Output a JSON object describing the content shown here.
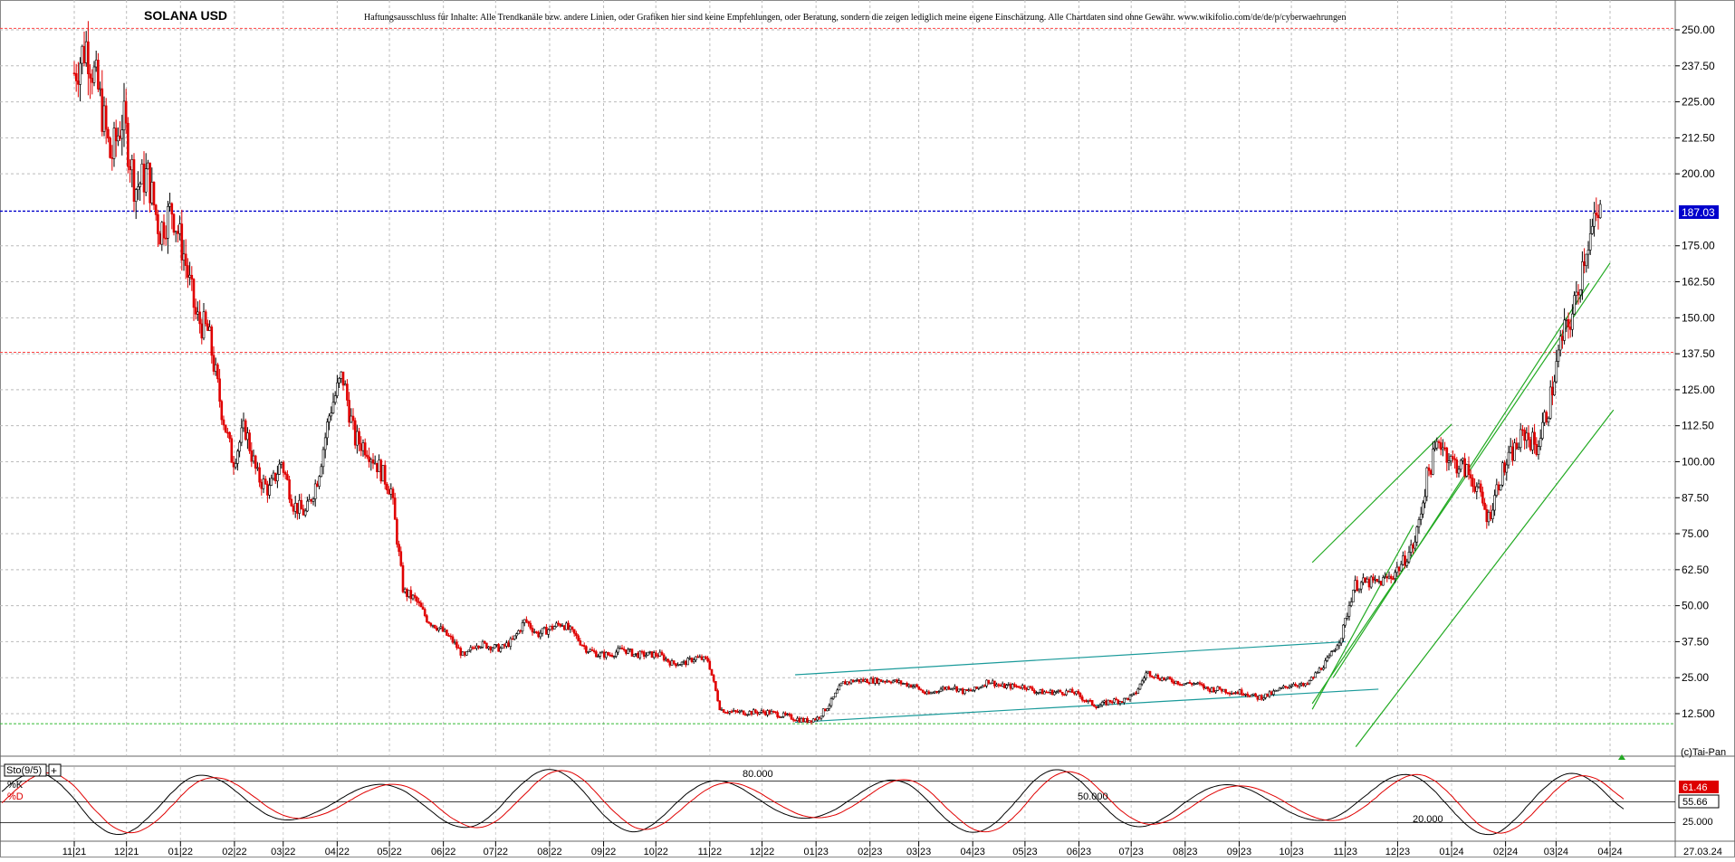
{
  "chart_data": {
    "type": "candlestick",
    "title": "SOLANA USD",
    "disclaimer": "Haftungsausschluss für Inhalte: Alle Trendkanäle bzw. andere Linien, oder Grafiken hier sind keine Empfehlungen, oder Beratung, sondern die zeigen lediglich meine eigene Einschätzung. Alle Chartdaten sind ohne Gewähr. www.wikifolio.com/de/de/p/cyberwaehrungen",
    "copyright": "(c)Tai-Pan",
    "y_ticks": [
      "250.00",
      "237.50",
      "225.00",
      "212.50",
      "200.00",
      "175.00",
      "162.50",
      "150.00",
      "137.50",
      "125.00",
      "112.50",
      "100.00",
      "87.50",
      "75.00",
      "62.50",
      "50.00",
      "37.50",
      "25.00",
      "12.500"
    ],
    "ylim": [
      0,
      254
    ],
    "last_price": "187.03",
    "x_ticks": [
      "11|21",
      "12|21",
      "01|22",
      "02|22",
      "03|22",
      "04|22",
      "05|22",
      "06|22",
      "07|22",
      "08|22",
      "09|22",
      "10|22",
      "11|22",
      "12|22",
      "01|23",
      "02|23",
      "03|23",
      "04|23",
      "05|23",
      "06|23",
      "07|23",
      "08|23",
      "09|23",
      "10|23",
      "11|23",
      "12|23",
      "01|24",
      "02|24",
      "03|24",
      "04|24"
    ],
    "x_date_label": "27.03.24",
    "reference_lines": [
      {
        "value": 250.5,
        "color": "#ff4444",
        "style": "dotted"
      },
      {
        "value": 187.03,
        "color": "#0000cc",
        "style": "dotted"
      },
      {
        "value": 138,
        "color": "#ff4444",
        "style": "dotted"
      },
      {
        "value": 9,
        "color": "#33bb33",
        "style": "dotted"
      }
    ],
    "price_path": [
      [
        "2021-11-01",
        235
      ],
      [
        "2021-11-08",
        245
      ],
      [
        "2021-11-15",
        228
      ],
      [
        "2021-11-22",
        205
      ],
      [
        "2021-11-29",
        220
      ],
      [
        "2021-12-06",
        195
      ],
      [
        "2021-12-13",
        200
      ],
      [
        "2021-12-20",
        180
      ],
      [
        "2021-12-27",
        188
      ],
      [
        "2022-01-03",
        172
      ],
      [
        "2022-01-10",
        150
      ],
      [
        "2022-01-17",
        145
      ],
      [
        "2022-01-24",
        120
      ],
      [
        "2022-01-31",
        100
      ],
      [
        "2022-02-07",
        112
      ],
      [
        "2022-02-14",
        95
      ],
      [
        "2022-02-21",
        90
      ],
      [
        "2022-02-28",
        100
      ],
      [
        "2022-03-07",
        85
      ],
      [
        "2022-03-14",
        82
      ],
      [
        "2022-03-21",
        95
      ],
      [
        "2022-03-28",
        118
      ],
      [
        "2022-04-04",
        130
      ],
      [
        "2022-04-11",
        108
      ],
      [
        "2022-04-18",
        105
      ],
      [
        "2022-04-25",
        98
      ],
      [
        "2022-05-02",
        90
      ],
      [
        "2022-05-09",
        55
      ],
      [
        "2022-05-16",
        52
      ],
      [
        "2022-05-23",
        45
      ],
      [
        "2022-05-30",
        42
      ],
      [
        "2022-06-06",
        38
      ],
      [
        "2022-06-13",
        32
      ],
      [
        "2022-06-20",
        37
      ],
      [
        "2022-06-27",
        36
      ],
      [
        "2022-07-04",
        35
      ],
      [
        "2022-07-11",
        38
      ],
      [
        "2022-07-18",
        45
      ],
      [
        "2022-07-25",
        40
      ],
      [
        "2022-08-01",
        42
      ],
      [
        "2022-08-08",
        44
      ],
      [
        "2022-08-15",
        40
      ],
      [
        "2022-08-22",
        35
      ],
      [
        "2022-08-29",
        33
      ],
      [
        "2022-09-05",
        33
      ],
      [
        "2022-09-12",
        35
      ],
      [
        "2022-09-19",
        33
      ],
      [
        "2022-09-26",
        33
      ],
      [
        "2022-10-03",
        33
      ],
      [
        "2022-10-10",
        30
      ],
      [
        "2022-10-17",
        30
      ],
      [
        "2022-10-24",
        32
      ],
      [
        "2022-10-31",
        31
      ],
      [
        "2022-11-07",
        14
      ],
      [
        "2022-11-14",
        13
      ],
      [
        "2022-11-21",
        13
      ],
      [
        "2022-11-28",
        13
      ],
      [
        "2022-12-05",
        13
      ],
      [
        "2022-12-12",
        12
      ],
      [
        "2022-12-19",
        11
      ],
      [
        "2022-12-26",
        10
      ],
      [
        "2023-01-02",
        11
      ],
      [
        "2023-01-09",
        16
      ],
      [
        "2023-01-16",
        23
      ],
      [
        "2023-01-23",
        24
      ],
      [
        "2023-01-30",
        24
      ],
      [
        "2023-02-06",
        24
      ],
      [
        "2023-02-13",
        24
      ],
      [
        "2023-02-20",
        23
      ],
      [
        "2023-02-27",
        22
      ],
      [
        "2023-03-06",
        19
      ],
      [
        "2023-03-13",
        21
      ],
      [
        "2023-03-20",
        22
      ],
      [
        "2023-03-27",
        20
      ],
      [
        "2023-04-03",
        21
      ],
      [
        "2023-04-10",
        24
      ],
      [
        "2023-04-17",
        22
      ],
      [
        "2023-04-24",
        22
      ],
      [
        "2023-05-01",
        22
      ],
      [
        "2023-05-08",
        20
      ],
      [
        "2023-05-15",
        20
      ],
      [
        "2023-05-22",
        20
      ],
      [
        "2023-05-29",
        20
      ],
      [
        "2023-06-05",
        17
      ],
      [
        "2023-06-12",
        15
      ],
      [
        "2023-06-19",
        17
      ],
      [
        "2023-06-26",
        17
      ],
      [
        "2023-07-03",
        19
      ],
      [
        "2023-07-10",
        27
      ],
      [
        "2023-07-17",
        25
      ],
      [
        "2023-07-24",
        24
      ],
      [
        "2023-07-31",
        23
      ],
      [
        "2023-08-07",
        23
      ],
      [
        "2023-08-14",
        21
      ],
      [
        "2023-08-21",
        21
      ],
      [
        "2023-08-28",
        20
      ],
      [
        "2023-09-04",
        20
      ],
      [
        "2023-09-11",
        18
      ],
      [
        "2023-09-18",
        19
      ],
      [
        "2023-09-25",
        21
      ],
      [
        "2023-10-02",
        23
      ],
      [
        "2023-10-09",
        22
      ],
      [
        "2023-10-16",
        27
      ],
      [
        "2023-10-23",
        32
      ],
      [
        "2023-10-30",
        40
      ],
      [
        "2023-11-06",
        57
      ],
      [
        "2023-11-13",
        58
      ],
      [
        "2023-11-20",
        58
      ],
      [
        "2023-11-27",
        60
      ],
      [
        "2023-12-04",
        65
      ],
      [
        "2023-12-11",
        72
      ],
      [
        "2023-12-18",
        95
      ],
      [
        "2023-12-25",
        108
      ],
      [
        "2024-01-01",
        100
      ],
      [
        "2024-01-08",
        98
      ],
      [
        "2024-01-15",
        92
      ],
      [
        "2024-01-22",
        80
      ],
      [
        "2024-01-29",
        95
      ],
      [
        "2024-02-05",
        103
      ],
      [
        "2024-02-12",
        110
      ],
      [
        "2024-02-19",
        105
      ],
      [
        "2024-02-26",
        120
      ],
      [
        "2024-03-04",
        142
      ],
      [
        "2024-03-11",
        152
      ],
      [
        "2024-03-18",
        175
      ],
      [
        "2024-03-27",
        187
      ]
    ],
    "channels": [
      {
        "color": "#1a9a9a",
        "points": [
          [
            "2022-12-20",
            26
          ],
          [
            "2023-11-01",
            37.5
          ]
        ]
      },
      {
        "color": "#1a9a9a",
        "points": [
          [
            "2022-12-20",
            9.5
          ],
          [
            "2023-11-20",
            21
          ]
        ]
      },
      {
        "color": "#22aa22",
        "points": [
          [
            "2023-10-13",
            65
          ],
          [
            "2024-01-01",
            113
          ]
        ]
      },
      {
        "color": "#22aa22",
        "points": [
          [
            "2023-10-25",
            25
          ],
          [
            "2024-03-20",
            162
          ]
        ]
      },
      {
        "color": "#22aa22",
        "points": [
          [
            "2023-10-13",
            16
          ],
          [
            "2024-04-01",
            169
          ]
        ]
      },
      {
        "color": "#22aa22",
        "points": [
          [
            "2023-10-13",
            14
          ],
          [
            "2023-12-10",
            78
          ]
        ]
      },
      {
        "color": "#22aa22",
        "points": [
          [
            "2023-11-07",
            1
          ],
          [
            "2024-04-03",
            118
          ]
        ]
      }
    ],
    "indicator": {
      "name": "Sto(9/5)",
      "k_label": "%K",
      "d_label": "%D",
      "k_value": "61.46",
      "d_value": "55.66",
      "levels": [
        "80.000",
        "50.000",
        "20.000"
      ],
      "right_tick": "25.000"
    }
  }
}
